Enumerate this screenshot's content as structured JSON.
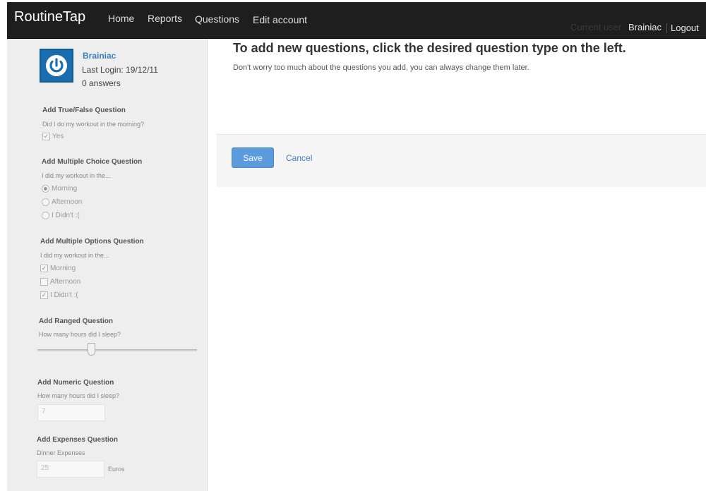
{
  "nav": {
    "brand": "RoutineTap",
    "links": [
      "Home",
      "Reports",
      "Questions",
      "Edit account"
    ],
    "current_user_label": "Current user",
    "user_name": "Brainiac",
    "logout": "Logout"
  },
  "profile": {
    "name": "Brainiac",
    "last_login": "Last Login: 19/12/11",
    "answers": "0 answers"
  },
  "sidebar": {
    "true_false": {
      "title": "Add True/False Question",
      "question": "Did I do my workout in the morning?",
      "option": "Yes"
    },
    "multiple_choice": {
      "title": "Add Multiple Choice Question",
      "question": "I did my workout in the...",
      "options": [
        "Morning",
        "Afternoon",
        "I Didn't :("
      ]
    },
    "multiple_options": {
      "title": "Add Multiple Options Question",
      "question": "I did my workout in the...",
      "options": [
        "Morning",
        "Afternoon",
        "I Didn't :("
      ]
    },
    "ranged": {
      "title": "Add Ranged Question",
      "question": "How many hours did I sleep?",
      "slider_value": 0.33
    },
    "numeric": {
      "title": "Add Numeric Question",
      "question": "How many hours did I sleep?",
      "value": "7"
    },
    "expenses": {
      "title": "Add Expenses Question",
      "question": "Dinner Expenses",
      "value": "25",
      "unit": "Euros"
    }
  },
  "main": {
    "heading": "To add new questions, click the desired question type on the left.",
    "subtext": "Don't worry too much about the questions you add, you can always change them later.",
    "save_label": "Save",
    "cancel_label": "Cancel"
  },
  "colors": {
    "navbar": "#1e1e1e",
    "accent": "#5b9bdc",
    "link": "#3b7fc4",
    "avatar": "#1a6eb0"
  }
}
